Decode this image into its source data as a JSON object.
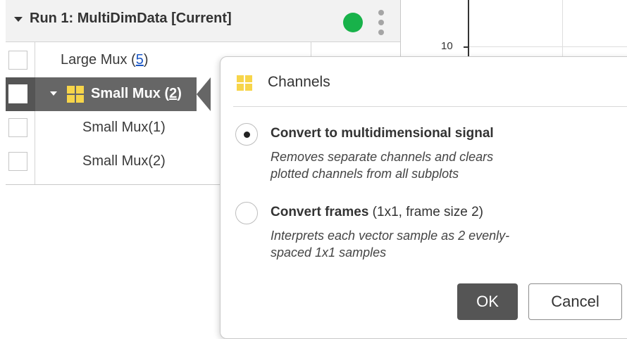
{
  "run": {
    "title": "Run 1: MultiDimData [Current]",
    "status_color": "#18b24a"
  },
  "tree": {
    "rows": [
      {
        "label": "Large Mux (",
        "count": "5",
        "suffix": ")"
      },
      {
        "label": "Small Mux (",
        "count": "2",
        "suffix": ")"
      },
      {
        "label": "Small Mux(1)"
      },
      {
        "label": "Small Mux(2)"
      }
    ],
    "selected_color": "#666666"
  },
  "plot": {
    "ytick": "10"
  },
  "dialog": {
    "title": "Channels",
    "options": [
      {
        "title": "Convert to multidimensional signal",
        "detail": "",
        "desc_line1": "Removes separate channels and clears",
        "desc_line2": "plotted channels from all subplots",
        "selected": true
      },
      {
        "title": "Convert frames",
        "detail": "(1x1, frame size 2)",
        "desc_line1": "Interprets each vector sample as 2 evenly-",
        "desc_line2": "spaced 1x1 samples",
        "selected": false
      }
    ],
    "ok_label": "OK",
    "cancel_label": "Cancel"
  },
  "colors": {
    "accent_icon": "#f7d54a",
    "ok_button": "#555555"
  }
}
